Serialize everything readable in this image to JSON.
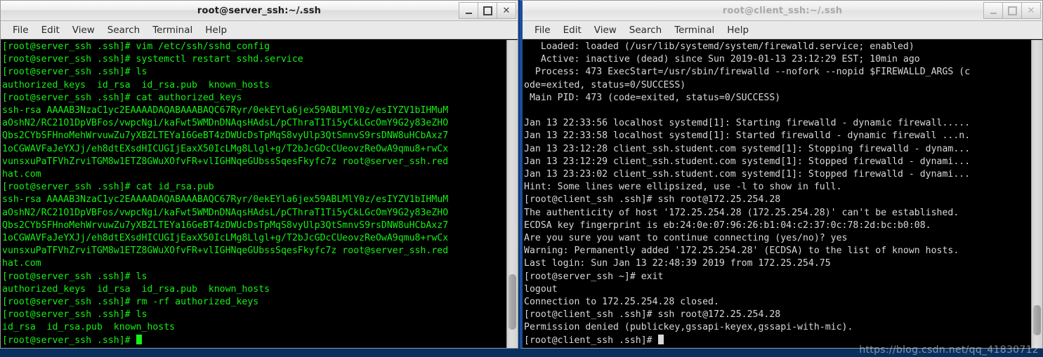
{
  "desktop": {
    "watermark": "https://blog.csdn.net/qq_41830712"
  },
  "windows": {
    "left": {
      "title": "root@server_ssh:~/.ssh",
      "active": true,
      "menu": [
        "File",
        "Edit",
        "View",
        "Search",
        "Terminal",
        "Help"
      ],
      "controls": {
        "minimize": "minimize-button",
        "maximize": "maximize-button",
        "close": "close-button"
      },
      "terminal": {
        "fg": "#14f014",
        "bg": "#000000",
        "lines": [
          "[root@server_ssh .ssh]# vim /etc/ssh/sshd_config",
          "[root@server_ssh .ssh]# systemctl restart sshd.service",
          "[root@server_ssh .ssh]# ls",
          "authorized_keys  id_rsa  id_rsa.pub  known_hosts",
          "[root@server_ssh .ssh]# cat authorized_keys",
          "ssh-rsa AAAAB3NzaC1yc2EAAAADAQABAAABAQC67Ryr/0ekEYla6jex59ABLMlY0z/esIYZV1bIHMuM",
          "aOshN2/RC21O1DpVBFos/vwpcNgi/kaFwt5WMDnDNAqsHAdsL/pCThraT1Ti5yCkLGcOmY9G2y83eZHO",
          "Qbs2CYbSFHnoMehWrvuwZu7yXBZLTEYa16GeBT4zDWUcDsTpMqS8vyUlp3QtSmnvS9rsDNW8uHCbAxz7",
          "1oCGWAVFaJeYXJj/eh8dtEXsdHICUGIjEaxX50IcLMg8Llgl+g/T2bJcGDcCUeovzReOwA9qmu8+rwCx",
          "vunsxuPaTFVhZrviTGM8w1ETZ8GWuXOfvFR+vlIGHNqeGUbssSqesFkyfc7z root@server_ssh.red",
          "hat.com",
          "[root@server_ssh .ssh]# cat id_rsa.pub",
          "ssh-rsa AAAAB3NzaC1yc2EAAAADAQABAAABAQC67Ryr/0ekEYla6jex59ABLMlY0z/esIYZV1bIHMuM",
          "aOshN2/RC21O1DpVBFos/vwpcNgi/kaFwt5WMDnDNAqsHAdsL/pCThraT1Ti5yCkLGcOmY9G2y83eZHO",
          "Qbs2CYbSFHnoMehWrvuwZu7yXBZLTEYa16GeBT4zDWUcDsTpMqS8vyUlp3QtSmnvS9rsDNW8uHCbAxz7",
          "1oCGWAVFaJeYXJj/eh8dtEXsdHICUGIjEaxX50IcLMg8Llgl+g/T2bJcGDcCUeovzReOwA9qmu8+rwCx",
          "vunsxuPaTFVhZrviTGM8w1ETZ8GWuXOfvFR+vlIGHNqeGUbssSqesFkyfc7z root@server_ssh.red",
          "hat.com",
          "[root@server_ssh .ssh]# ls",
          "authorized_keys  id_rsa  id_rsa.pub  known_hosts",
          "[root@server_ssh .ssh]# rm -rf authorized_keys",
          "[root@server_ssh .ssh]# ls",
          "id_rsa  id_rsa.pub  known_hosts"
        ],
        "prompt": "[root@server_ssh .ssh]# "
      }
    },
    "right": {
      "title": "root@client_ssh:~/.ssh",
      "active": false,
      "menu": [
        "File",
        "Edit",
        "View",
        "Search",
        "Terminal",
        "Help"
      ],
      "controls": {
        "minimize": "minimize-button",
        "maximize": "maximize-button",
        "close": "close-button"
      },
      "terminal": {
        "fg": "#d8d8d8",
        "bg": "#000000",
        "lines": [
          "   Loaded: loaded (/usr/lib/systemd/system/firewalld.service; enabled)",
          "   Active: inactive (dead) since Sun 2019-01-13 23:12:29 EST; 10min ago",
          "  Process: 473 ExecStart=/usr/sbin/firewalld --nofork --nopid $FIREWALLD_ARGS (c",
          "ode=exited, status=0/SUCCESS)",
          " Main PID: 473 (code=exited, status=0/SUCCESS)",
          "",
          "Jan 13 22:33:56 localhost systemd[1]: Starting firewalld - dynamic firewall.....",
          "Jan 13 22:33:58 localhost systemd[1]: Started firewalld - dynamic firewall ...n.",
          "Jan 13 23:12:28 client_ssh.student.com systemd[1]: Stopping firewalld - dynam...",
          "Jan 13 23:12:29 client_ssh.student.com systemd[1]: Stopped firewalld - dynami...",
          "Jan 13 23:23:02 client_ssh.student.com systemd[1]: Stopped firewalld - dynami...",
          "Hint: Some lines were ellipsized, use -l to show in full.",
          "[root@client_ssh .ssh]# ssh root@172.25.254.28",
          "The authenticity of host '172.25.254.28 (172.25.254.28)' can't be established.",
          "ECDSA key fingerprint is eb:24:0e:07:96:26:b1:04:c2:37:0c:78:2d:bc:b0:08.",
          "Are you sure you want to continue connecting (yes/no)? yes",
          "Warning: Permanently added '172.25.254.28' (ECDSA) to the list of known hosts.",
          "Last login: Sun Jan 13 22:48:39 2019 from 172.25.254.75",
          "[root@server_ssh ~]# exit",
          "logout",
          "Connection to 172.25.254.28 closed.",
          "[root@client_ssh .ssh]# ssh root@172.25.254.28",
          "Permission denied (publickey,gssapi-keyex,gssapi-with-mic)."
        ],
        "prompt": "[root@client_ssh .ssh]# "
      }
    }
  }
}
